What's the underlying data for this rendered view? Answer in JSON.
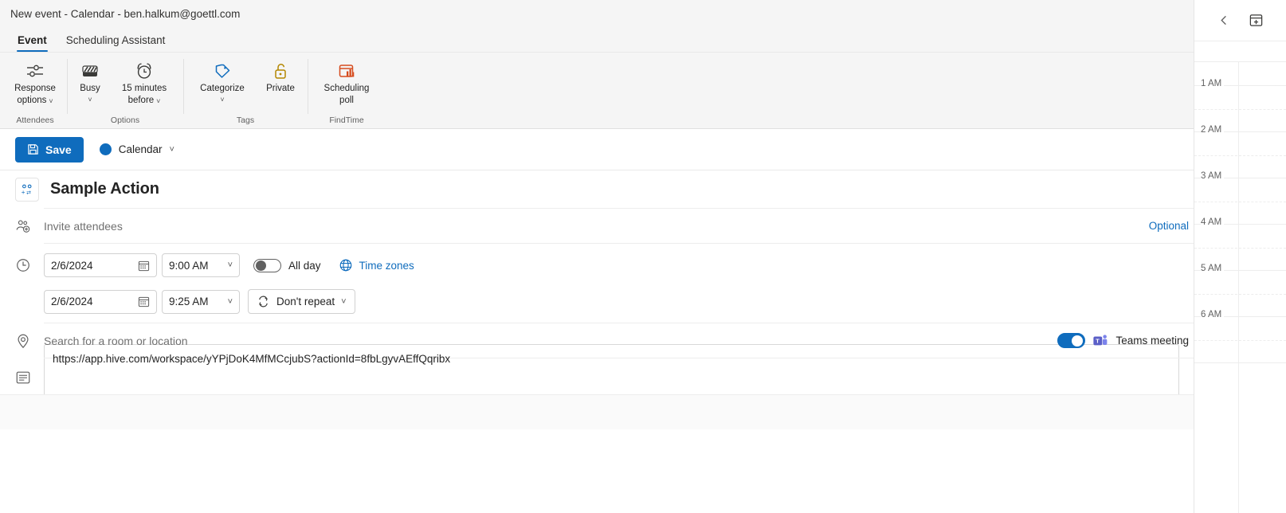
{
  "window": {
    "title": "New event - Calendar - ben.halkum@goettl.com"
  },
  "tabs": [
    {
      "label": "Event",
      "active": true
    },
    {
      "label": "Scheduling Assistant",
      "active": false
    }
  ],
  "ribbon": {
    "groups": [
      {
        "name": "Attendees",
        "buttons": [
          {
            "label_line1": "Response",
            "label_line2": "options",
            "icon": "response-options-icon",
            "has_chevron": true
          }
        ]
      },
      {
        "name": "Options",
        "buttons": [
          {
            "label_line1": "Busy",
            "label_line2": "",
            "icon": "busy-icon",
            "has_chevron": true
          },
          {
            "label_line1": "15 minutes",
            "label_line2": "before",
            "icon": "reminder-alarm-icon",
            "has_chevron": true
          }
        ]
      },
      {
        "name": "Tags",
        "buttons": [
          {
            "label_line1": "Categorize",
            "label_line2": "",
            "icon": "categorize-tag-icon",
            "has_chevron": true
          },
          {
            "label_line1": "Private",
            "label_line2": "",
            "icon": "private-lock-icon",
            "has_chevron": false
          }
        ]
      },
      {
        "name": "FindTime",
        "buttons": [
          {
            "label_line1": "Scheduling",
            "label_line2": "poll",
            "icon": "scheduling-poll-icon",
            "has_chevron": false
          }
        ]
      }
    ]
  },
  "commandbar": {
    "save_label": "Save",
    "calendar_label": "Calendar",
    "calendar_color": "#0f6cbd"
  },
  "form": {
    "event_title": "Sample Action",
    "attendees_placeholder": "Invite attendees",
    "optional_label": "Optional",
    "start_date": "2/6/2024",
    "start_time": "9:00 AM",
    "end_date": "2/6/2024",
    "end_time": "9:25 AM",
    "all_day_label": "All day",
    "all_day_on": false,
    "time_zones_label": "Time zones",
    "repeat_label": "Don't repeat",
    "location_placeholder": "Search for a room or location",
    "teams_meeting_label": "Teams meeting",
    "teams_meeting_on": true,
    "body_text": "https://app.hive.com/workspace/yYPjDoK4MfMCcjubS?actionId=8fbLgyvAEffQqribx",
    "editor_tools": [
      "attach-file-icon",
      "insert-picture-icon",
      "insert-emoji-icon",
      "dictate-icon",
      "draw-ink-icon",
      "loop-component-icon",
      "insert-document-icon"
    ]
  },
  "calendar_pane": {
    "prev_label": "‹",
    "hours": [
      "1 AM",
      "2 AM",
      "3 AM",
      "4 AM",
      "5 AM",
      "6 AM"
    ]
  },
  "colors": {
    "accent": "#0f6cbd",
    "link": "#0f6cbd",
    "teams_purple": "#5b5fc7",
    "tag_blue": "#0f6cbd",
    "lock_gold": "#b38600",
    "poll_orange": "#d64c1e",
    "emoji_yellow": "#f2c230"
  }
}
